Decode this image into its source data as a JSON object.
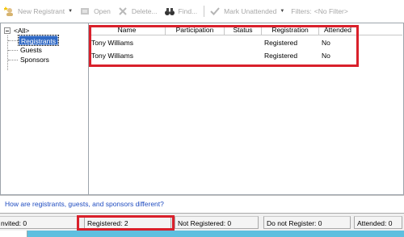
{
  "toolbar": {
    "new_registrant": "New Registrant",
    "open": "Open",
    "delete": "Delete...",
    "find": "Find...",
    "mark_unattended": "Mark Unattended",
    "filters_label": "Filters:",
    "filters_value": "<No Filter>"
  },
  "tree": {
    "root": "<All>",
    "items": [
      "Registrants",
      "Guests",
      "Sponsors"
    ],
    "selected": "Registrants"
  },
  "grid": {
    "columns": [
      "Name",
      "Participation",
      "Status",
      "Registration",
      "Attended"
    ],
    "rows": [
      {
        "name": "Tony Williams",
        "participation": "",
        "status": "",
        "registration": "Registered",
        "attended": "No"
      },
      {
        "name": "Tony Williams",
        "participation": "",
        "status": "",
        "registration": "Registered",
        "attended": "No"
      }
    ]
  },
  "help_link": "How are registrants, guests, and sponsors different?",
  "status": {
    "invited": "nvited: 0",
    "registered": "Registered: 2",
    "not_registered": "Not Registered: 0",
    "do_not_register": "Do not Register: 0",
    "attended": "Attended: 0"
  },
  "colors": {
    "highlight_box": "#d9202b",
    "selection": "#316ac5",
    "link": "#1f4cc0"
  }
}
